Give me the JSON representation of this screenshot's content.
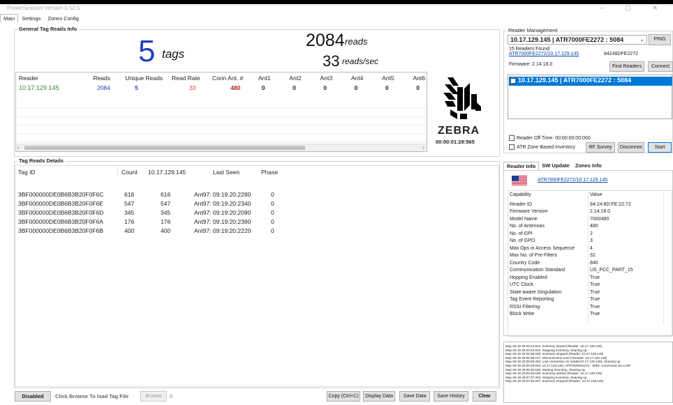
{
  "window": {
    "title": "PowerSession  Version 0.52.5",
    "controls": "–  ▢  ✕"
  },
  "tabs": [
    "Main",
    "Settings",
    "Zones Config"
  ],
  "general": {
    "title": "General Tag Reads Info",
    "tags_count": "5",
    "tags_label": "tags",
    "reads_count": "2084",
    "reads_label": "reads",
    "rate_count": "33",
    "rate_label": "reads/sec"
  },
  "reader_table": {
    "headers": [
      "Reader",
      "Reads",
      "Unique Reads",
      "Read Rate",
      "Conn Ant. #",
      "Ant1",
      "Ant2",
      "Ant3",
      "Ant4",
      "Ant5",
      "Ant6"
    ],
    "row": [
      "10.17.129.145",
      "2084",
      "5",
      "33",
      "480",
      "0",
      "0",
      "0",
      "0",
      "0",
      "0"
    ]
  },
  "logo": {
    "brand": "ZEBRA",
    "timer": "00:00:01:28:565"
  },
  "tag_details": {
    "title": "Tag Reads Details",
    "headers": [
      "Tag ID",
      "Count",
      "10.17.129.145",
      "Last Seen",
      "Phase"
    ],
    "rows": [
      [
        "3BF000000DE0B6B3B20F0F6C",
        "616",
        "616",
        "Ant97: 09:19:20:2280",
        "0"
      ],
      [
        "3BF000000DE0B6B3B20F0F6E",
        "547",
        "547",
        "Ant97: 09:19:20:2340",
        "0"
      ],
      [
        "3BF000000DE0B6B3B20F0F6D",
        "345",
        "345",
        "Ant97: 09:19:20:2090",
        "0"
      ],
      [
        "3BF000000DE0B6B3B20F0F6A",
        "176",
        "176",
        "Ant97: 09:19:20:2380",
        "0"
      ],
      [
        "3BF000000DE0B6B3B20F0F6B",
        "400",
        "400",
        "Ant97: 09:19:20:2220",
        "0"
      ]
    ]
  },
  "bottom_bar": {
    "disabled_label": "Disabled",
    "hint": "Click Browse To load Tag File",
    "browse": "Browse",
    "count": "0",
    "copy": "Copy (Ctrl+C)",
    "display": "Display Data",
    "save": "Save Data",
    "history": "Save History",
    "clear": "Clear"
  },
  "reader_mgmt": {
    "title": "Reader Management",
    "selected": "10.17.129.145  |  ATR7000FE2272 : 5084",
    "ping": "PING",
    "found": "15 Readers Found",
    "link": "ATR7000FE2272/10.17.129.145",
    "mac": "84248DFE2272",
    "firmware": "Firmware: 2.14.18.0",
    "find": "Find Readers",
    "connect": "Connect",
    "list_item": "10.17.129.145  |  ATR7000FE2272 : 5084",
    "off_time": "Reader Off Time:  00:00:00:00:000",
    "zone_inventory": "ATR Zone Based Inventory",
    "rf_survey": "RF Survey",
    "disconnect": "Disconnec",
    "start": "Start"
  },
  "info_tabs": [
    "Reader Info",
    "SW Update",
    "Zones Info"
  ],
  "reader_info": {
    "link": "ATR7000FE2272/10.17.129.145",
    "headers": [
      "Capability",
      "Value"
    ],
    "rows": [
      [
        "Reader ID",
        "84:24:8D:FE:22:72"
      ],
      [
        "Firmware Version",
        "2.14.18.0"
      ],
      [
        "Model Name",
        "7000480"
      ],
      [
        "No. of Antennas",
        "480"
      ],
      [
        "No. of GPI",
        "2"
      ],
      [
        "No. of GPO",
        "3"
      ],
      [
        "Max Ops in Access Sequence",
        "4"
      ],
      [
        "Max No. of Pre-Filters",
        "32"
      ],
      [
        "Country Code",
        "840"
      ],
      [
        "Communication Standard",
        "US_FCC_PART_15"
      ],
      [
        "Hopping Enabled",
        "True"
      ],
      [
        "UTC Clock",
        "True"
      ],
      [
        "State-aware Singulation",
        "True"
      ],
      [
        "Tag Event Reporting",
        "True"
      ],
      [
        "RSSI Filtering",
        "True"
      ],
      [
        "Block Write",
        "True"
      ]
    ]
  },
  "log": [
    "May-25-18 20:04:24:912: Inventory started (Reader: 10.17.129.145)",
    "May-25-18 20:04:52:831: Stopping inventory, cleaning up",
    "May-25-18 20:04:56:825: Inventory stopped (Reader: 10.17.129.145)",
    "May-25-18 20:05:59:217: Disconnection event (Reader: 10.17.129.145)",
    "May-25-18 20:05:59:453: Lost connection on reader(10.17.129.145), cleaning up",
    "May-25-18 20:06:33:894: 10.17.129.145 | ATR7000FE2272 : 5084: Connected via LLRP",
    "May-25-18 20:06:36:530: Starting inventory, cleaning up",
    "May-25-18 20:06:36:628: Inventory started (Reader: 10.17.129.145)",
    "May-25-18 20:07:37:402: Stopping inventory, cleaning up",
    "May-25-18 20:07:40:257: Inventory stopped (Reader: 10.17.129.145)"
  ],
  "colors": {
    "green": "#2e8b2e",
    "blue": "#1f3fbf",
    "red": "#d03a2a",
    "dark_red": "#b22222",
    "selection": "#0078d7"
  }
}
